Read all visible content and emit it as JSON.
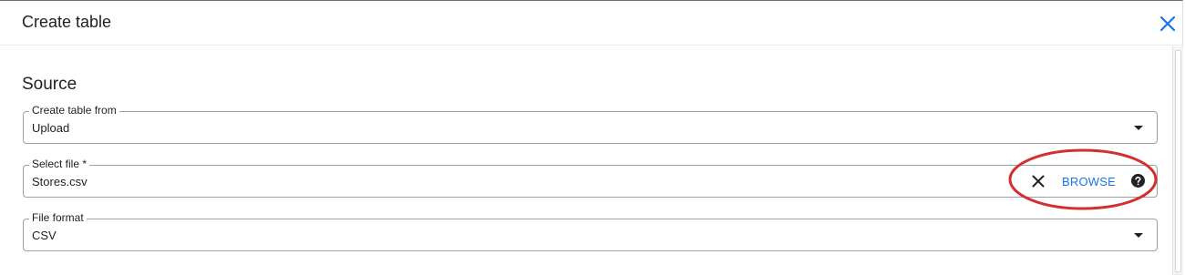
{
  "dialog": {
    "title": "Create table",
    "close_icon": "close-icon"
  },
  "source": {
    "section_title": "Source",
    "create_from": {
      "label": "Create table from",
      "value": "Upload",
      "icon": "dropdown-arrow-icon"
    },
    "select_file": {
      "label": "Select file *",
      "value": "Stores.csv",
      "clear_icon": "clear-icon",
      "browse_label": "BROWSE",
      "help_icon": "help-icon"
    },
    "file_format": {
      "label": "File format",
      "value": "CSV",
      "icon": "dropdown-arrow-icon"
    }
  },
  "colors": {
    "accent": "#1a73e8",
    "annotation": "#d32f2f",
    "border": "#9aa0a6"
  }
}
